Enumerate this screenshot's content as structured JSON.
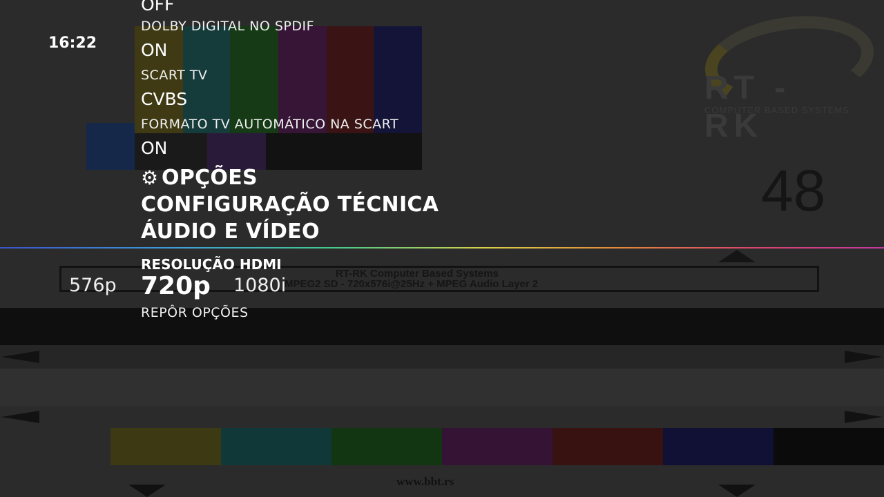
{
  "clock": "16:22",
  "menu": {
    "items": [
      {
        "label": "OFF",
        "kind": "value"
      },
      {
        "label": "DOLBY DIGITAL NO SPDIF",
        "kind": "label"
      },
      {
        "label": "ON",
        "kind": "value"
      },
      {
        "label": "SCART TV",
        "kind": "label"
      },
      {
        "label": "CVBS",
        "kind": "value"
      },
      {
        "label": "FORMATO TV AUTOMÁTICO NA SCART",
        "kind": "label"
      },
      {
        "label": "ON",
        "kind": "value"
      }
    ],
    "breadcrumb": [
      "OPÇÕES",
      "CONFIGURAÇÃO TÉCNICA",
      "ÁUDIO E VÍDEO"
    ],
    "breadcrumb_icon": "gear-icon"
  },
  "selected_setting": {
    "label": "RESOLUÇÃO HDMI",
    "options": [
      "576p",
      "720p",
      "1080i"
    ],
    "selected": "720p"
  },
  "next_setting": {
    "label": "REPÔR OPÇÕES"
  },
  "background": {
    "logo_text": "RT - RK",
    "logo_subtitle": "COMPUTER BASED SYSTEMS",
    "channel_number": "48",
    "info_line1": "RT-RK Computer Based Systems",
    "info_line2": "MPEG2 SD - 720x576i@25Hz + MPEG Audio Layer 2",
    "url": "www.bbt.rs"
  },
  "colors": {
    "divider": [
      "#3a53c8",
      "#46c98a",
      "#d8d04a",
      "#e2893a",
      "#c03a9f"
    ]
  }
}
